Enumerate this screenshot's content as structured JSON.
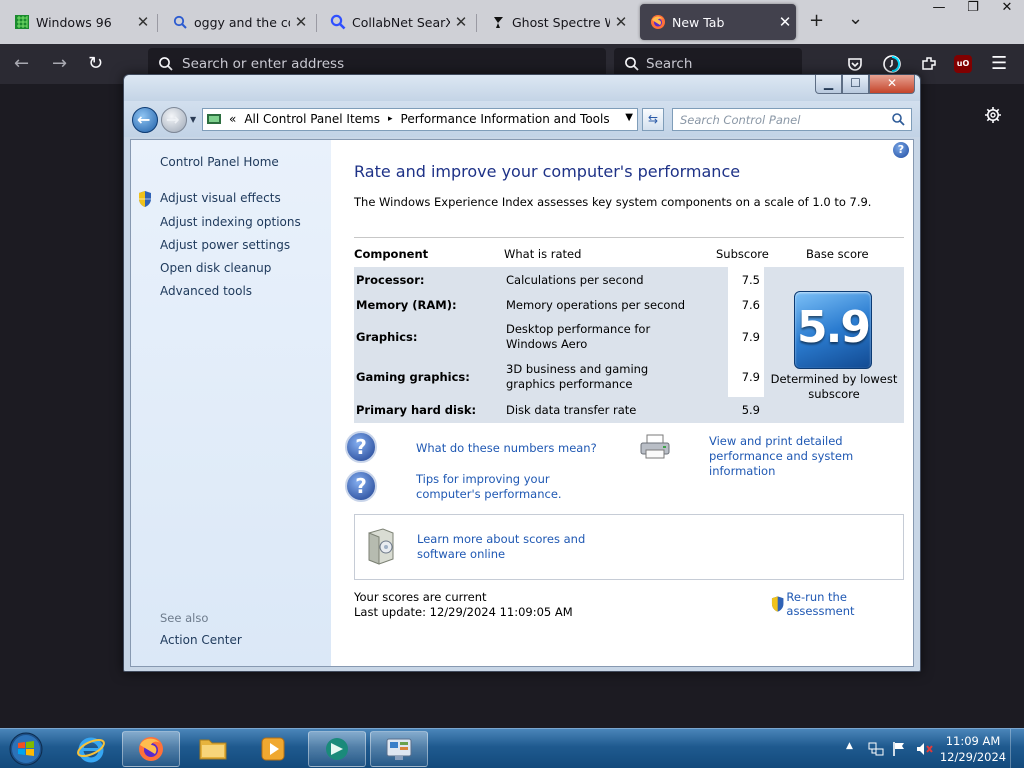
{
  "browser": {
    "tabs": [
      {
        "title": "Windows 96",
        "active": false
      },
      {
        "title": "oggy and the cockroaches",
        "active": false
      },
      {
        "title": "CollabNet SearXNG",
        "active": false
      },
      {
        "title": "Ghost Spectre Windows",
        "active": false
      },
      {
        "title": "New Tab",
        "active": true
      }
    ],
    "new_tab_label": "+",
    "tab_list_label": "⌄",
    "address_placeholder": "Search or enter address",
    "search_placeholder": "Search",
    "accent": "#42414d"
  },
  "window": {
    "address": {
      "crumbs": [
        "«",
        "All Control Panel Items",
        "▸",
        "Performance Information and Tools"
      ]
    },
    "search_placeholder": "Search Control Panel",
    "left_pane": {
      "home": "Control Panel Home",
      "links": [
        "Adjust visual effects",
        "Adjust indexing options",
        "Adjust power settings",
        "Open disk cleanup",
        "Advanced tools"
      ],
      "see_also_heading": "See also",
      "see_also": [
        "Action Center"
      ]
    },
    "main": {
      "title": "Rate and improve your computer's performance",
      "intro": "The Windows Experience Index assesses key system components on a scale of 1.0 to 7.9.",
      "columns": [
        "Component",
        "What is rated",
        "Subscore",
        "Base score"
      ],
      "rows": [
        {
          "component": "Processor:",
          "rated": "Calculations per second",
          "subscore": "7.5"
        },
        {
          "component": "Memory (RAM):",
          "rated": "Memory operations per second",
          "subscore": "7.6"
        },
        {
          "component": "Graphics:",
          "rated": "Desktop performance for Windows Aero",
          "subscore": "7.9"
        },
        {
          "component": "Gaming graphics:",
          "rated": "3D business and gaming graphics performance",
          "subscore": "7.9"
        },
        {
          "component": "Primary hard disk:",
          "rated": "Disk data transfer rate",
          "subscore": "5.9"
        }
      ],
      "base_score": "5.9",
      "base_caption": "Determined by lowest subscore",
      "links": {
        "numbers": "What do these numbers mean?",
        "tips": "Tips for improving your computer's performance.",
        "print": "View and print detailed performance and system information",
        "learn": "Learn more about scores and software online",
        "rerun": "Re-run the assessment"
      },
      "status": "Your scores are current",
      "last_update": "Last update: 12/29/2024 11:09:05 AM"
    }
  },
  "taskbar": {
    "time": "11:09 AM",
    "date": "12/29/2024"
  }
}
